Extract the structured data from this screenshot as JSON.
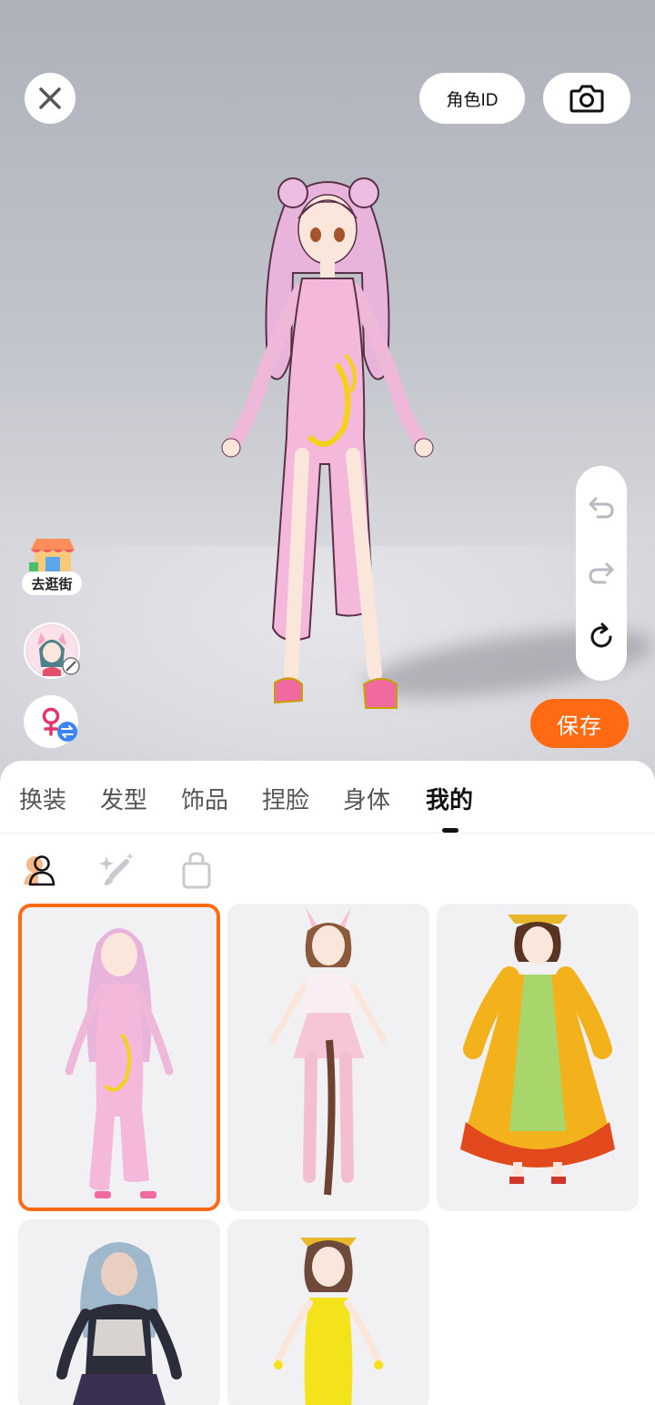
{
  "topbar": {
    "role_id_label": "角色ID"
  },
  "stage": {
    "shop_label": "去逛街",
    "save_label": "保存"
  },
  "tabs": [
    {
      "label": "换装",
      "active": false
    },
    {
      "label": "发型",
      "active": false
    },
    {
      "label": "饰品",
      "active": false
    },
    {
      "label": "捏脸",
      "active": false
    },
    {
      "label": "身体",
      "active": false
    },
    {
      "label": "我的",
      "active": true
    }
  ],
  "subtabs": [
    {
      "icon": "person-icon",
      "active": true
    },
    {
      "icon": "magic-brush-icon",
      "active": false
    },
    {
      "icon": "shopping-bag-icon",
      "active": false
    }
  ],
  "outfits": [
    {
      "name": "pink-qipao-outfit",
      "selected": true
    },
    {
      "name": "bunny-ears-pink-outfit",
      "selected": false
    },
    {
      "name": "yellow-hanfu-outfit",
      "selected": false
    },
    {
      "name": "dark-punk-outfit",
      "selected": false
    },
    {
      "name": "yellow-qipao-outfit",
      "selected": false
    }
  ],
  "colors": {
    "accent": "#ff6a13",
    "active_tab": "#111111",
    "inactive_tab": "#555555"
  }
}
